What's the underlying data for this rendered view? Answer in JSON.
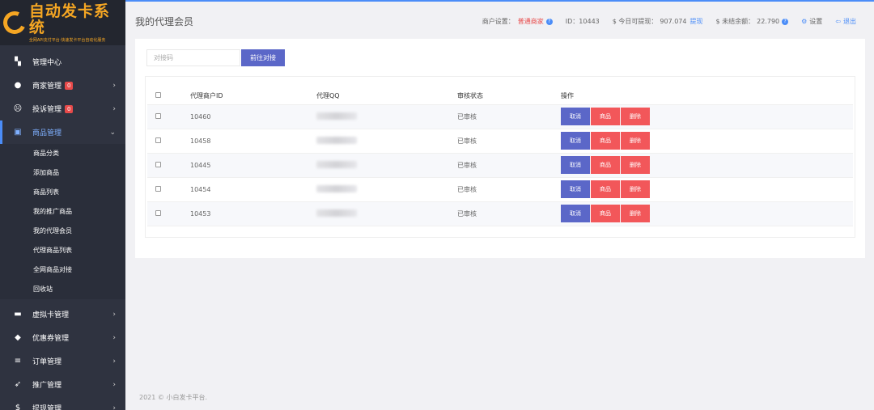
{
  "sidebar": {
    "logo_title": "自动发卡系统",
    "logo_sub": "全网API支付平台·快速发卡平台自动化服务",
    "items": [
      {
        "label": "管理中心",
        "icon": "dashboard-icon",
        "glyph": "▚",
        "arrow": false
      },
      {
        "label": "商家管理",
        "icon": "user-icon",
        "glyph": "●",
        "badge": "0",
        "arrow": true
      },
      {
        "label": "投诉管理",
        "icon": "face-icon",
        "glyph": "☹",
        "badge": "0",
        "arrow": true
      },
      {
        "label": "商品管理",
        "icon": "bag-icon",
        "glyph": "▣",
        "arrow": true,
        "active": true
      }
    ],
    "sub_items": [
      "商品分类",
      "添加商品",
      "商品列表",
      "我的推广商品",
      "我的代理会员",
      "代理商品列表",
      "全网商品对接",
      "回收站"
    ],
    "items_after": [
      {
        "label": "虚拟卡管理",
        "icon": "card-icon",
        "glyph": "▬"
      },
      {
        "label": "优惠券管理",
        "icon": "tag-icon",
        "glyph": "◆"
      },
      {
        "label": "订单管理",
        "icon": "list-icon",
        "glyph": "≡"
      },
      {
        "label": "推广管理",
        "icon": "send-icon",
        "glyph": "➶"
      },
      {
        "label": "提现管理",
        "icon": "dollar-icon",
        "glyph": "$"
      }
    ]
  },
  "header": {
    "title": "我的代理会员",
    "account_label": "商户设置：",
    "account_type": "普通商家",
    "id_label": "ID：",
    "id_value": "10443",
    "withdraw_label": "$ 今日可提现：",
    "withdraw_value": "907.074",
    "withdraw_link": "提现",
    "unsettled_label": "$ 未结余额：",
    "unsettled_value": "22.790",
    "settings": "设置",
    "logout": "退出"
  },
  "search": {
    "placeholder": "对接码",
    "button": "前往对接"
  },
  "table": {
    "headers": [
      "代理商户ID",
      "代理QQ",
      "审核状态",
      "操作"
    ],
    "rows": [
      {
        "id": "10460",
        "status": "已审核"
      },
      {
        "id": "10458",
        "status": "已审核"
      },
      {
        "id": "10445",
        "status": "已审核"
      },
      {
        "id": "10454",
        "status": "已审核"
      },
      {
        "id": "10453",
        "status": "已审核"
      }
    ],
    "actions": {
      "cancel": "取消",
      "goods": "商品",
      "delete": "删除"
    }
  },
  "footer": "2021 © 小白发卡平台."
}
